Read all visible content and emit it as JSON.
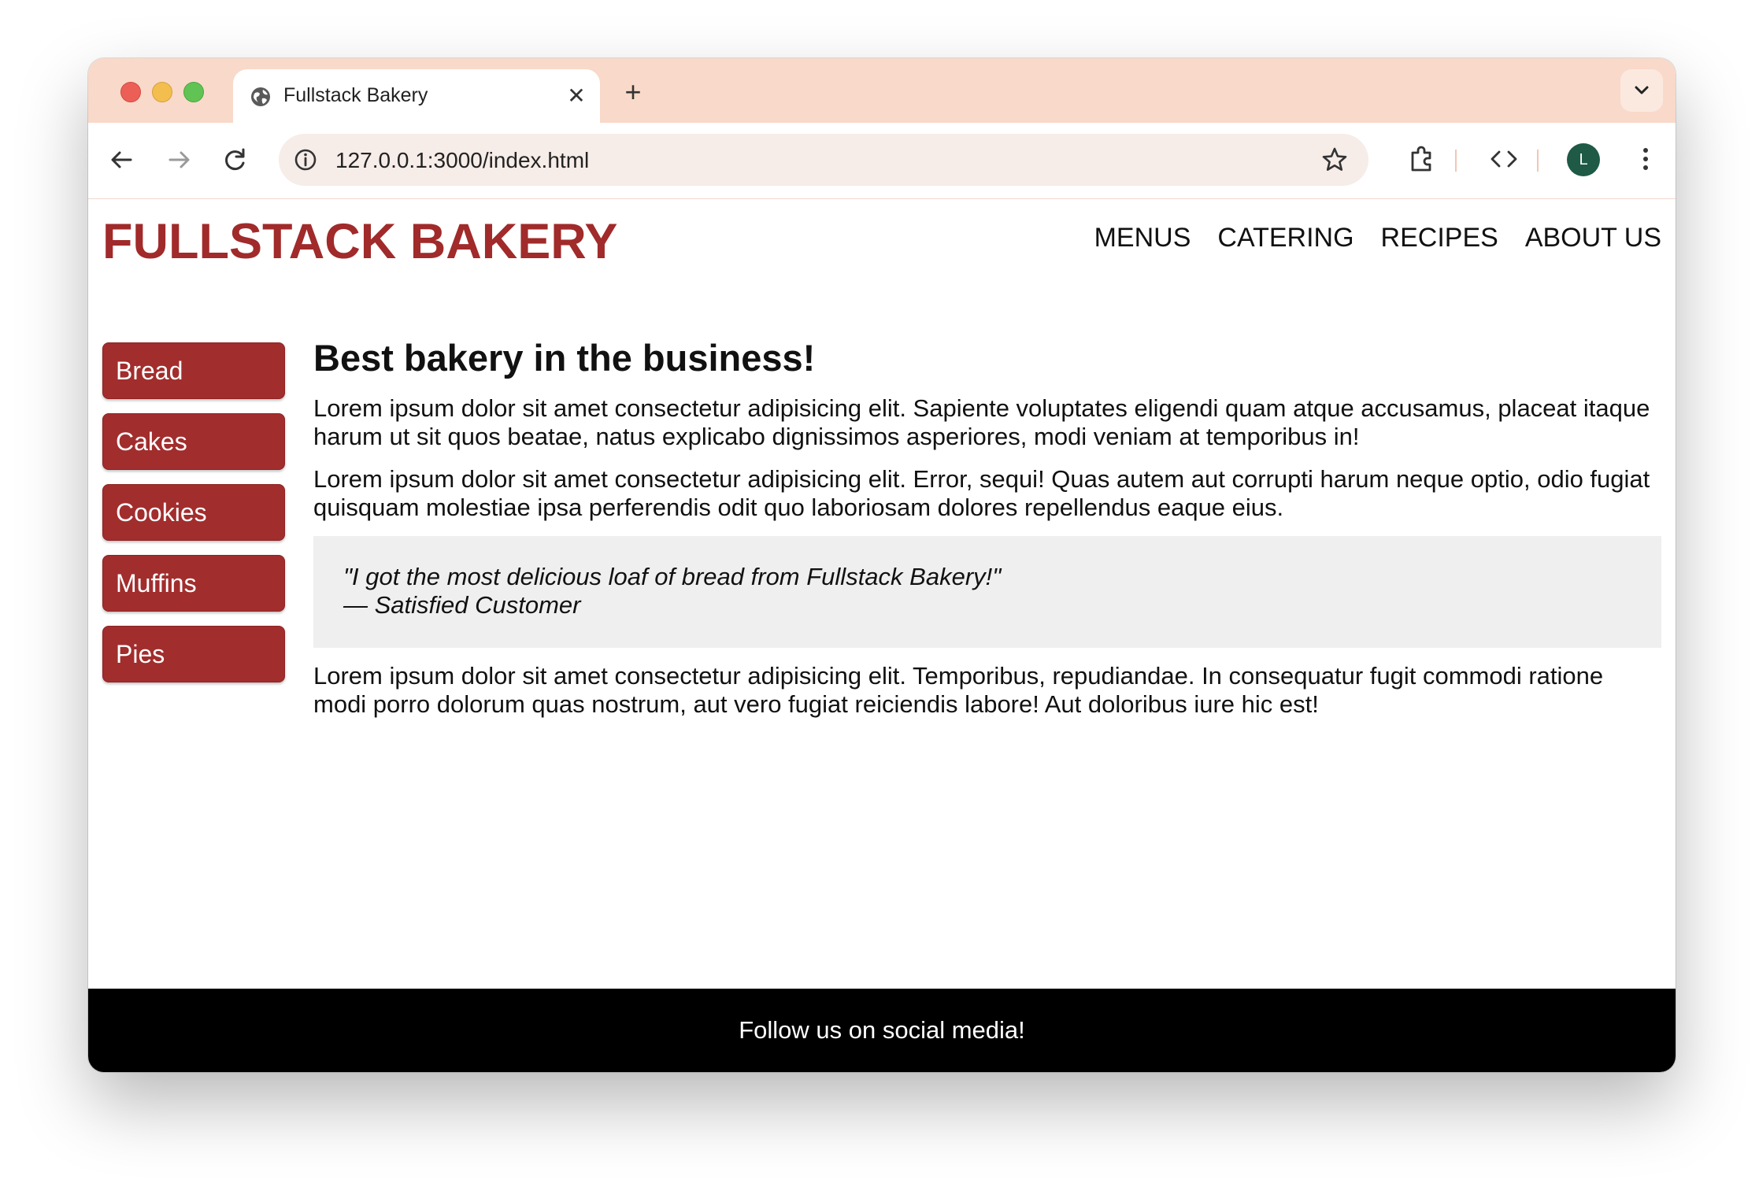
{
  "browser": {
    "tab": {
      "title": "Fullstack Bakery",
      "close_icon": "close-icon",
      "favicon": "globe-icon"
    },
    "new_tab_icon": "plus-icon",
    "tab_search_icon": "chevron-down-icon",
    "toolbar": {
      "back_icon": "arrow-left-icon",
      "forward_icon": "arrow-right-icon",
      "reload_icon": "reload-icon",
      "url": "127.0.0.1:3000/index.html",
      "site_info_icon": "info-icon",
      "bookmark_icon": "star-icon",
      "extensions_icon": "puzzle-icon",
      "devtools_icon": "code-icon",
      "profile_initial": "L",
      "menu_icon": "kebab-menu-icon"
    }
  },
  "page": {
    "brand": "FULLSTACK BAKERY",
    "nav": [
      "MENUS",
      "CATERING",
      "RECIPES",
      "ABOUT US"
    ],
    "sidebar": [
      "Bread",
      "Cakes",
      "Cookies",
      "Muffins",
      "Pies"
    ],
    "heading": "Best bakery in the business!",
    "paragraphs": [
      "Lorem ipsum dolor sit amet consectetur adipisicing elit. Sapiente voluptates eligendi quam atque accusamus, placeat itaque harum ut sit quos beatae, natus explicabo dignissimos asperiores, modi veniam at temporibus in!",
      "Lorem ipsum dolor sit amet consectetur adipisicing elit. Error, sequi! Quas autem aut corrupti harum neque optio, odio fugiat quisquam molestiae ipsa perferendis odit quo laboriosam dolores repellendus eaque eius.",
      "Lorem ipsum dolor sit amet consectetur adipisicing elit. Temporibus, repudiandae. In consequatur fugit commodi ratione modi porro dolorum quas nostrum, aut vero fugiat reiciendis labore! Aut doloribus iure hic est!"
    ],
    "quote": {
      "text": "\"I got the most delicious loaf of bread from Fullstack Bakery!\"",
      "attribution": "— Satisfied Customer"
    },
    "footer": "Follow us on social media!"
  },
  "colors": {
    "brand": "#a12a2a",
    "sidebar_button": "#a22d2d",
    "tabstrip": "#f9d9c9",
    "footer": "#000000",
    "quote_bg": "#efefef"
  }
}
